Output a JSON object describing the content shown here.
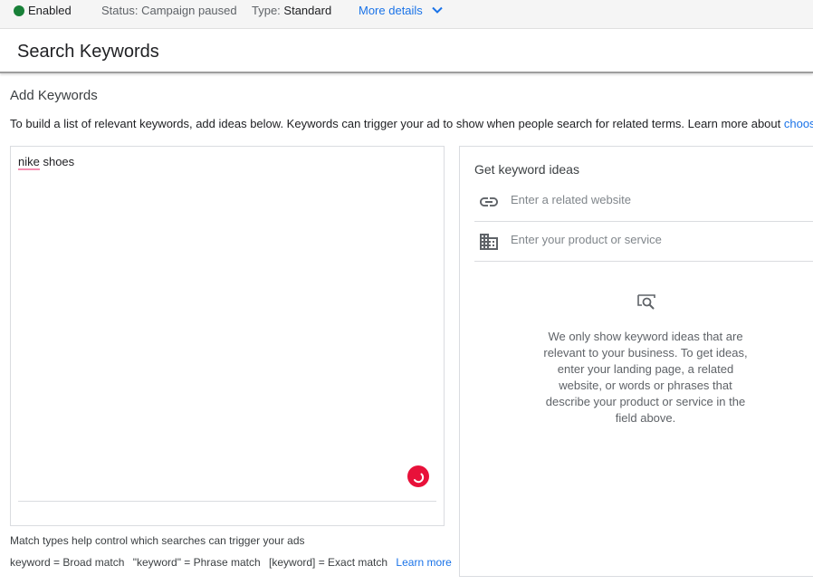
{
  "status_bar": {
    "enabled_label": "Enabled",
    "status_label": "Status:",
    "status_value": "Campaign paused",
    "type_label": "Type:",
    "type_value": "Standard",
    "more_details": "More details",
    "enabled_color": "#188038"
  },
  "header": {
    "title": "Search Keywords"
  },
  "add_keywords": {
    "title": "Add Keywords",
    "intro": "To build a list of relevant keywords, add ideas below. Keywords can trigger your ad to show when people search for related terms. Learn more about ",
    "intro_link": "choos",
    "editor": {
      "word1": "nike",
      "word2": " shoes"
    }
  },
  "match_types": {
    "help": "Match types help control which searches can trigger your ads",
    "broad": "keyword = Broad match",
    "phrase": "\"keyword\" = Phrase match",
    "exact": "[keyword] = Exact match",
    "learn_more": "Learn more"
  },
  "keyword_ideas": {
    "heading": "Get keyword ideas",
    "website": {
      "icon": "link-icon",
      "placeholder": "Enter a related website",
      "value": ""
    },
    "product": {
      "icon": "business-icon",
      "placeholder": "Enter your product or service",
      "value": ""
    },
    "empty_icon": "search-idea-icon",
    "empty_text": "We only show keyword ideas that are relevant to your business. To get ideas, enter your landing page, a related website, or words or phrases that describe your product or service in the field above."
  },
  "colors": {
    "accent": "#1a73e8",
    "spinner": "#e8113a",
    "spell_underline": "#f48fb1"
  }
}
